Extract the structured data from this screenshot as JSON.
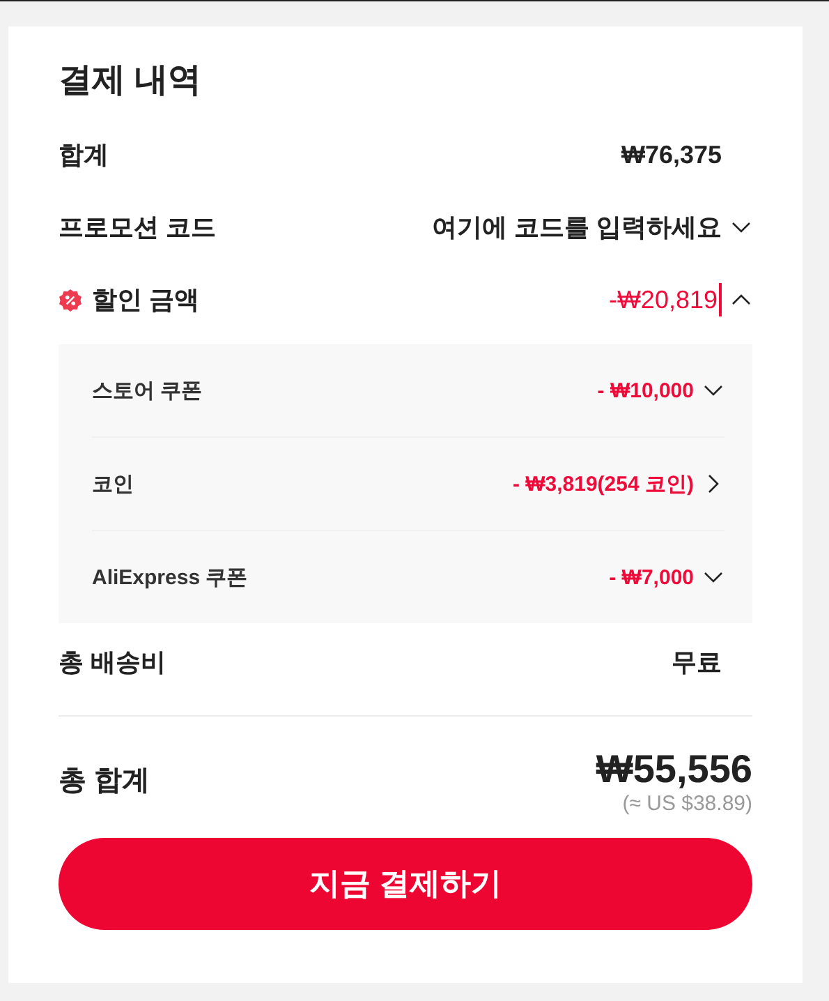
{
  "title": "결제 내역",
  "rows": [
    {
      "label": "합계",
      "value": "₩76,375",
      "kind": "plain"
    },
    {
      "label": "프로모션 코드",
      "value": "여기에 코드를 입력하세요",
      "kind": "dropdown"
    }
  ],
  "discount": {
    "label": "할인 금액",
    "value": "-₩20,819",
    "expanded": true,
    "items": [
      {
        "label": "스토어 쿠폰",
        "value": "- ₩10,000",
        "kind": "dropdown"
      },
      {
        "label": "코인",
        "value": "- ₩3,819(254 코인)",
        "kind": "link"
      },
      {
        "label": "AliExpress 쿠폰",
        "value": "- ₩7,000",
        "kind": "dropdown"
      }
    ]
  },
  "shipping": {
    "label": "총 배송비",
    "value": "무료"
  },
  "total": {
    "label": "총 합계",
    "value": "₩55,556",
    "converted": "(≈ US $38.89)"
  },
  "pay_button": "지금 결제하기"
}
